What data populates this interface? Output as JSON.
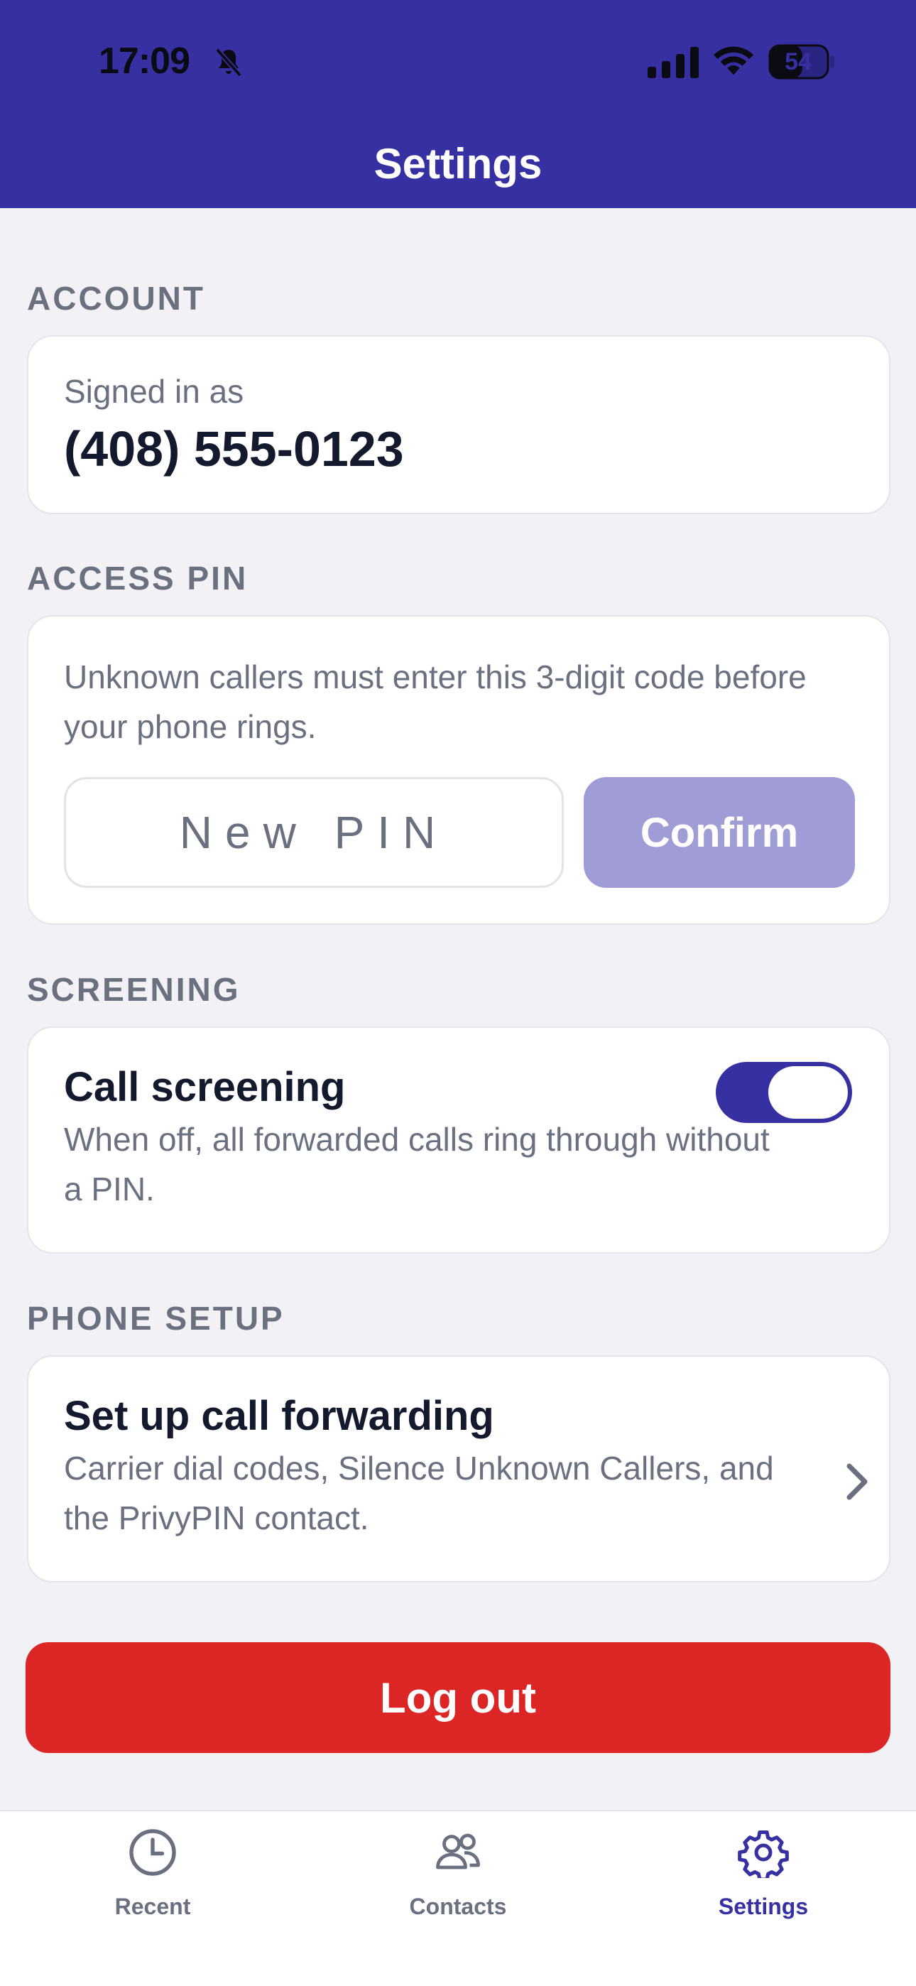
{
  "status_bar": {
    "time": "17:09",
    "battery": "54"
  },
  "header": {
    "title": "Settings"
  },
  "account": {
    "section_label": "ACCOUNT",
    "signed_in_label": "Signed in as",
    "phone_number": "(408) 555-0123"
  },
  "access_pin": {
    "section_label": "ACCESS PIN",
    "description": "Unknown callers must enter this 3-digit code before your phone rings.",
    "input_placeholder": "New PIN",
    "input_value": "",
    "confirm_label": "Confirm"
  },
  "screening": {
    "section_label": "SCREENING",
    "title": "Call screening",
    "description": "When off, all forwarded calls ring through without a PIN.",
    "enabled": true
  },
  "phone_setup": {
    "section_label": "PHONE SETUP",
    "title": "Set up call forwarding",
    "description": "Carrier dial codes, Silence Unknown Callers, and the PrivyPIN contact."
  },
  "logout": {
    "label": "Log out"
  },
  "tabbar": {
    "tabs": [
      {
        "label": "Recent",
        "icon": "clock-icon",
        "active": false
      },
      {
        "label": "Contacts",
        "icon": "people-icon",
        "active": false
      },
      {
        "label": "Settings",
        "icon": "gear-icon",
        "active": true
      }
    ]
  },
  "colors": {
    "brand": "#3730a3",
    "confirm_disabled": "#9f9cd6",
    "danger": "#dc2626",
    "background": "#f2f2f6"
  }
}
